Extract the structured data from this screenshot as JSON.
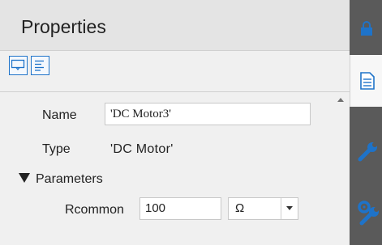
{
  "header": {
    "title": "Properties"
  },
  "toolbar": {
    "buttons": [
      {
        "icon": "tooltip-view-icon"
      },
      {
        "icon": "text-view-icon"
      }
    ]
  },
  "properties": {
    "name_label": "Name",
    "name_value": "'DC Motor3'",
    "type_label": "Type",
    "type_value": "'DC Motor'",
    "group_label": "Parameters",
    "rcommon_label": "Rcommon",
    "rcommon_value": "100",
    "rcommon_unit": "Ω"
  },
  "sidebar": {
    "tabs": [
      {
        "icon": "lock-icon"
      },
      {
        "icon": "document-icon",
        "active": true
      },
      {
        "icon": "wrench-icon"
      },
      {
        "icon": "wrench-gear-icon"
      }
    ]
  },
  "colors": {
    "accent": "#1e73c9",
    "sidebar_bg": "#5a5a5a",
    "sidebar_icon": "#1e73c9"
  }
}
